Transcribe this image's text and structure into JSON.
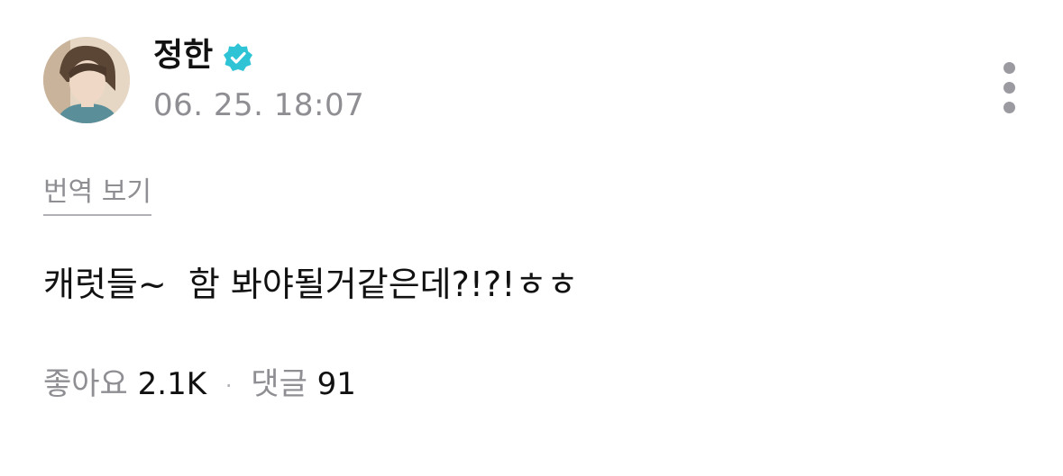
{
  "author": {
    "name": "정한",
    "verified": true,
    "avatar_icon": "profile-photo"
  },
  "post": {
    "timestamp": "06. 25. 18:07",
    "translate_label": "번역 보기",
    "body": "캐럿들~  함 봐야될거같은데?!?!ㅎㅎ"
  },
  "stats": {
    "likes_label": "좋아요",
    "likes_count": "2.1K",
    "separator": "·",
    "comments_label": "댓글",
    "comments_count": "91"
  },
  "colors": {
    "verified_badge": "#2ec4d6",
    "muted_text": "#8e8e93",
    "primary_text": "#111111"
  },
  "icons": {
    "more": "more-vertical-icon",
    "verified": "verified-badge-icon"
  }
}
